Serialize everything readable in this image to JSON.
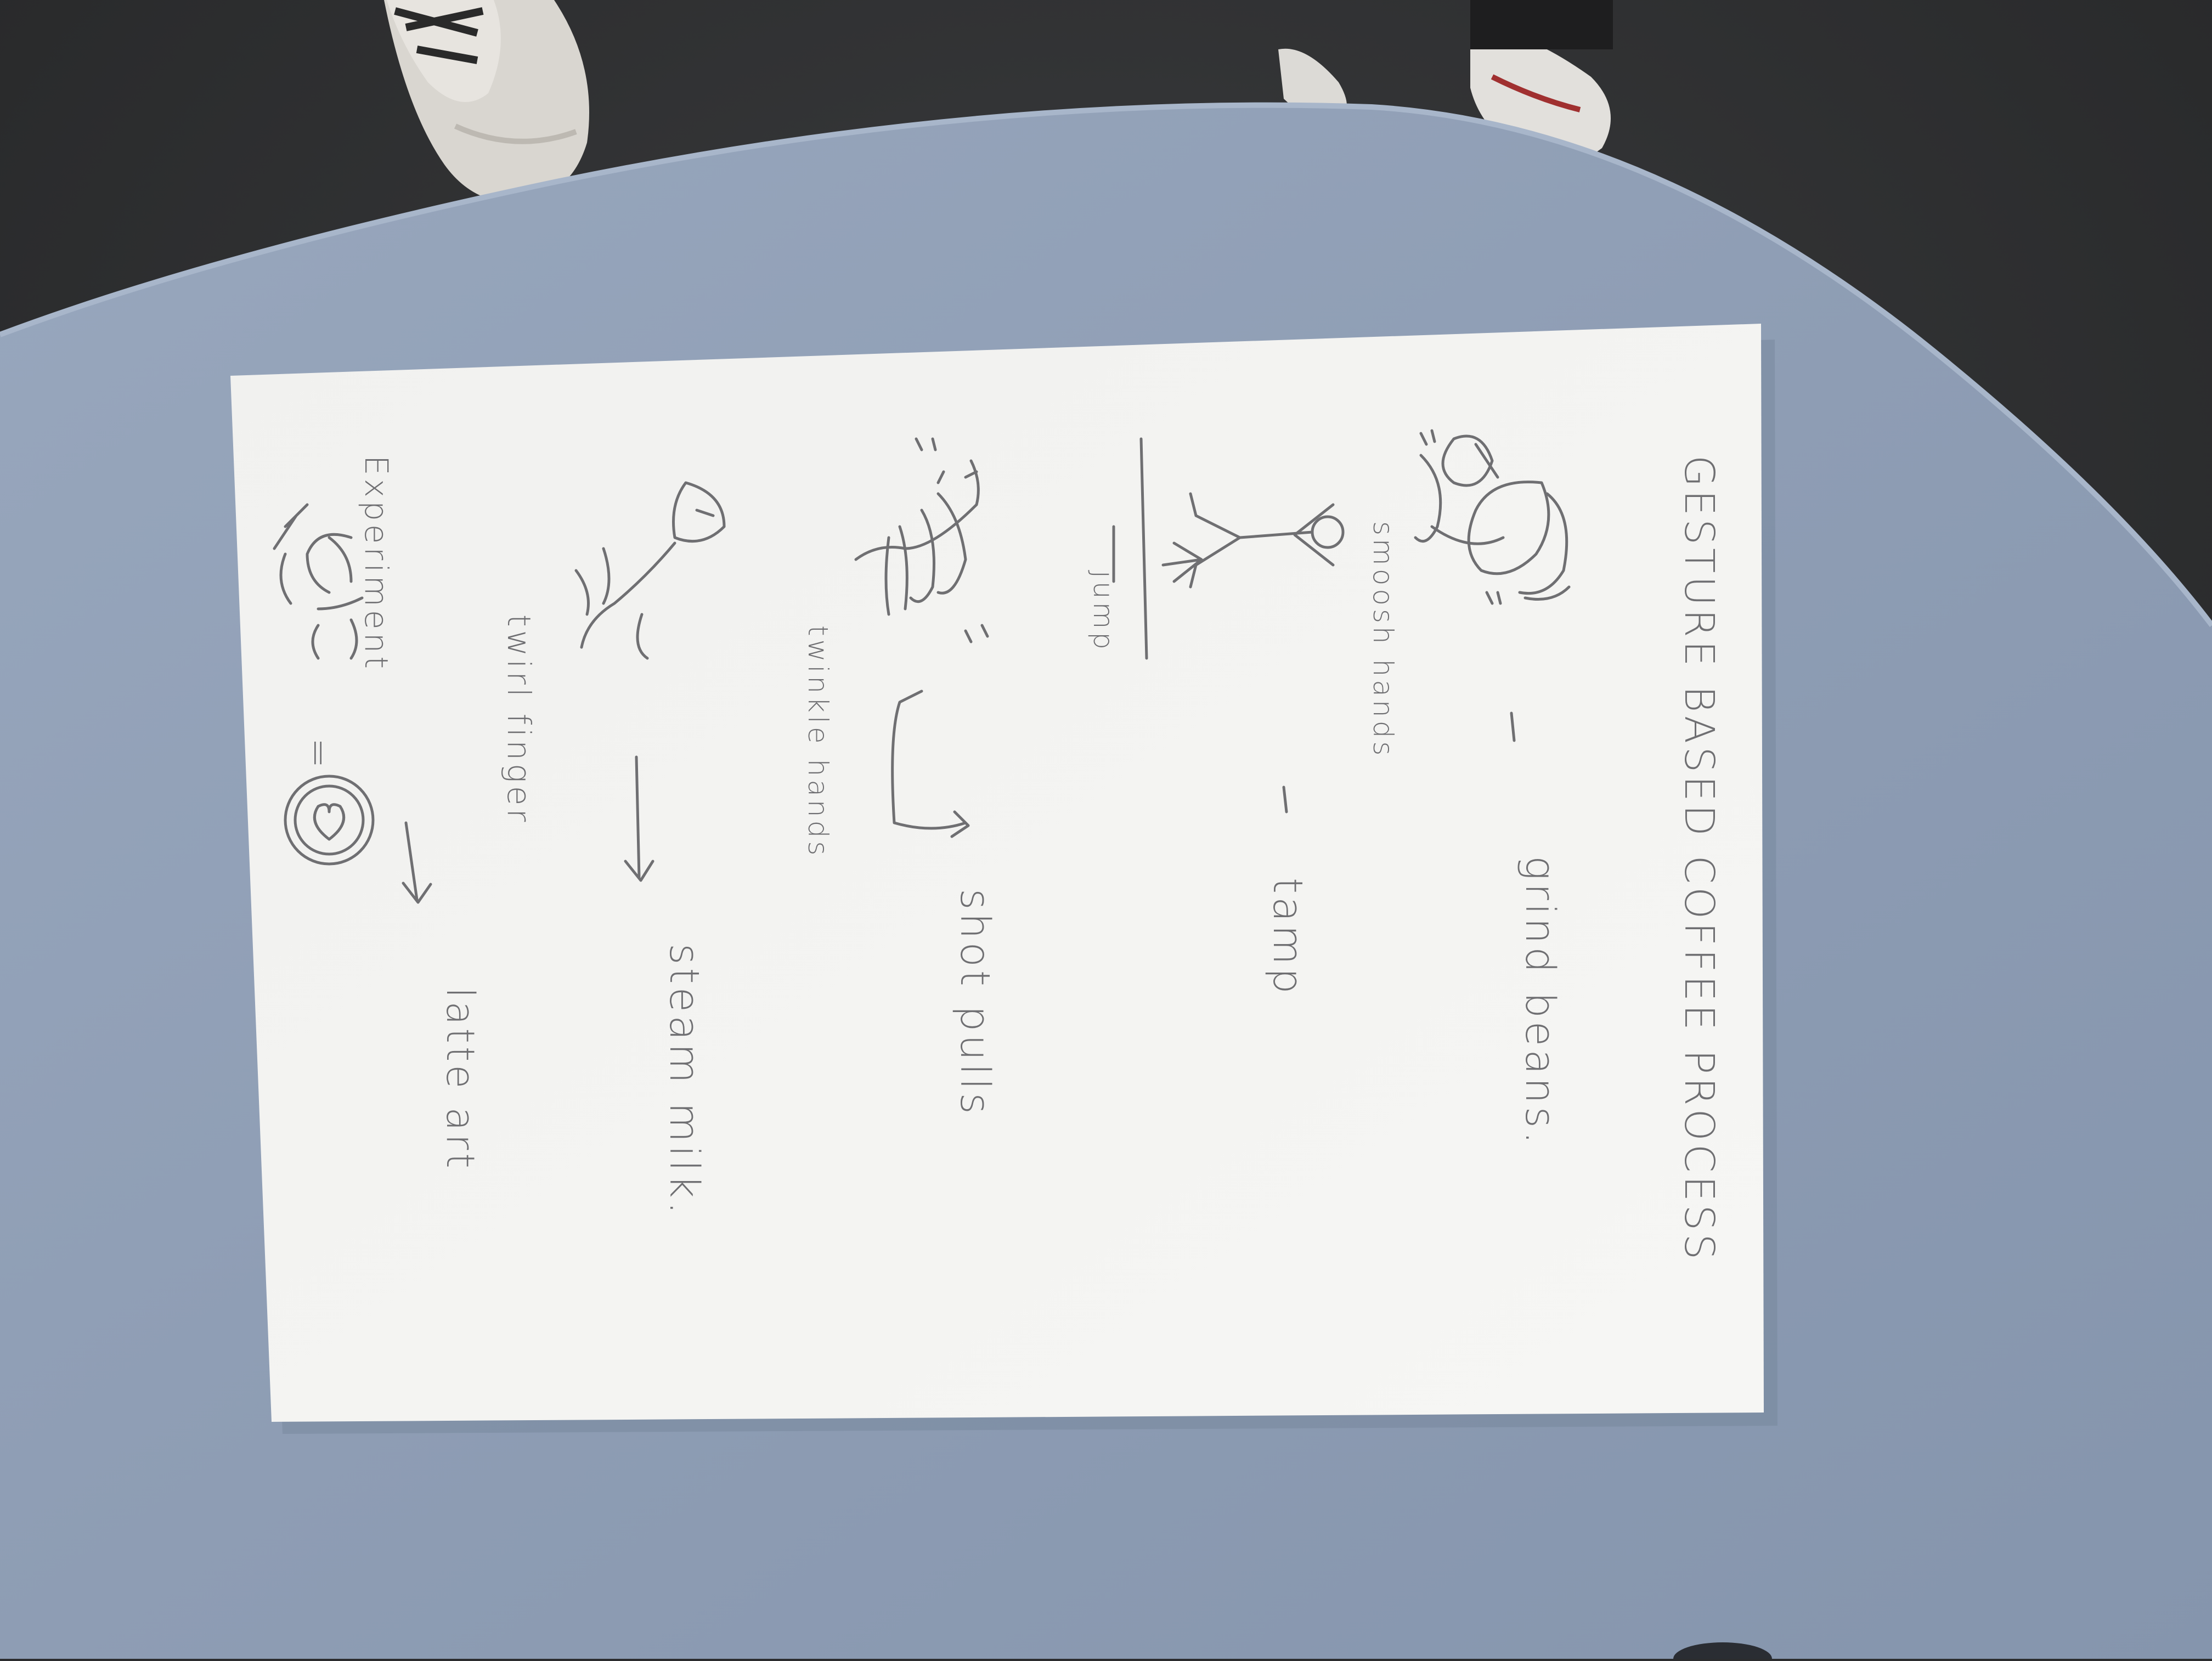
{
  "sketch": {
    "title": "GESTURE BASED COFFEE PROCESS",
    "steps": [
      {
        "gesture_label": "smoosh hands",
        "action": "grind beans."
      },
      {
        "gesture_label": "",
        "action": "tamp"
      },
      {
        "gesture_label": "jump",
        "action": ""
      },
      {
        "gesture_label": "twinkle hands",
        "action": "shot pulls"
      },
      {
        "gesture_label": "twirl finger",
        "action": "steam milk."
      },
      {
        "gesture_label": "Experiment",
        "action": "latte art"
      }
    ],
    "equals": "="
  },
  "colors": {
    "paper": "#f4f4f2",
    "desk": "#8c9cb4",
    "carpet": "#2b2c2e",
    "pencil": "#6f6f72"
  }
}
